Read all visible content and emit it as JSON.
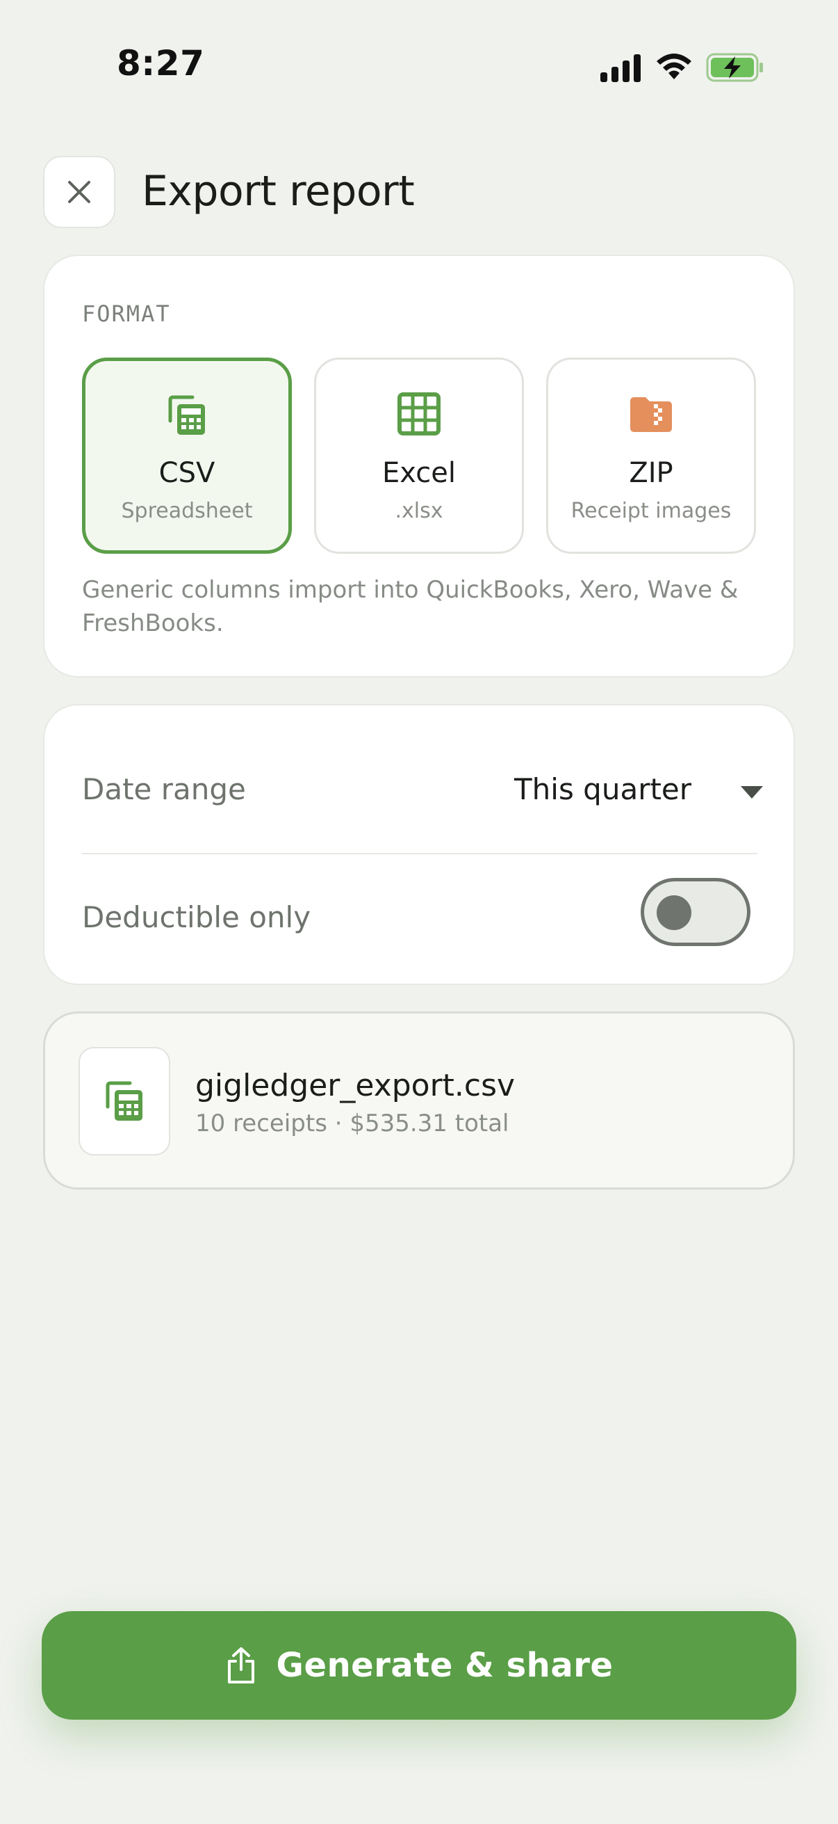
{
  "status_bar": {
    "time": "8:27"
  },
  "header": {
    "title": "Export report",
    "close_icon": "close-icon"
  },
  "format": {
    "section_label": "FORMAT",
    "options": [
      {
        "name": "CSV",
        "sub": "Spreadsheet",
        "icon": "spreadsheet-calculator-icon",
        "selected": true
      },
      {
        "name": "Excel",
        "sub": ".xlsx",
        "icon": "grid-table-icon",
        "selected": false
      },
      {
        "name": "ZIP",
        "sub": "Receipt images",
        "icon": "zip-folder-icon",
        "selected": false
      }
    ],
    "note": "Generic columns import into QuickBooks, Xero, Wave & FreshBooks."
  },
  "options": {
    "date_range_label": "Date range",
    "date_range_value": "This quarter",
    "deductible_label": "Deductible only",
    "deductible_enabled": false
  },
  "file": {
    "name": "gigledger_export.csv",
    "meta": "10 receipts · $535.31 total",
    "icon": "spreadsheet-calculator-icon"
  },
  "action": {
    "label": "Generate & share",
    "icon": "share-icon"
  },
  "colors": {
    "accent": "#5a9e47",
    "zip_icon": "#e48f5c",
    "background": "#f0f2ee"
  }
}
